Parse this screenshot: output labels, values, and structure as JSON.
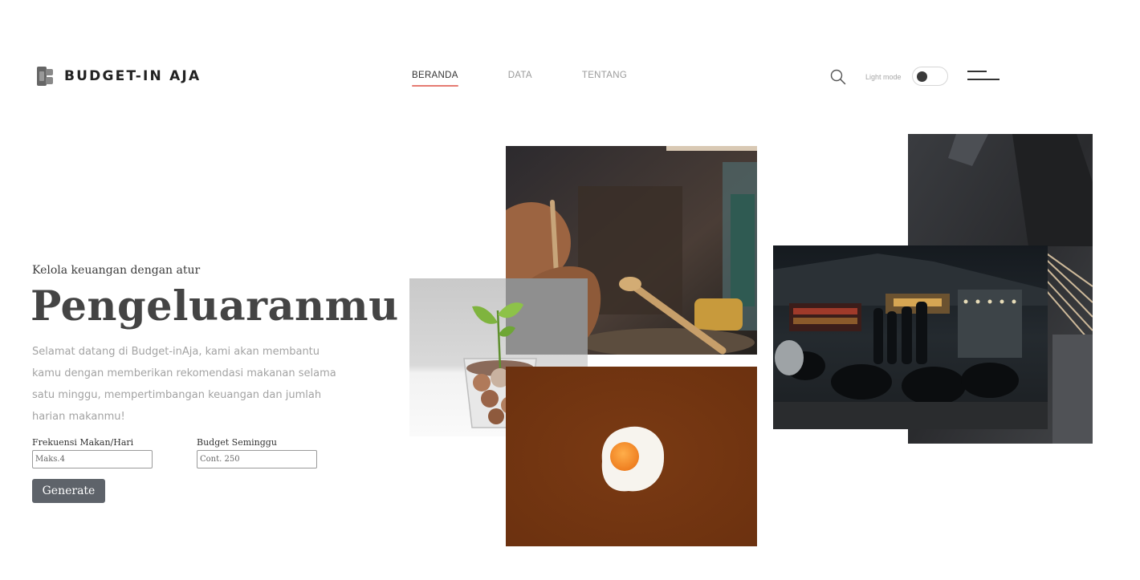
{
  "header": {
    "logo_text": "BUDGET-IN AJA",
    "logo_icon": "budget-logo-icon",
    "nav": [
      {
        "label": "BERANDA",
        "active": true
      },
      {
        "label": "DATA",
        "active": false
      },
      {
        "label": "TENTANG",
        "active": false
      }
    ],
    "search_icon": "search-icon",
    "mode_label": "Light mode",
    "mode_toggle_on": true,
    "menu_icon": "hamburger-menu-icon"
  },
  "hero": {
    "subtitle": "Kelola keuangan dengan atur",
    "title": "Pengeluaranmu",
    "description": "Selamat datang di Budget-inAja, kami akan membantu kamu dengan memberikan rekomendasi makanan selama satu minggu, mempertimbangan keuangan dan jumlah harian makanmu!"
  },
  "form": {
    "frequency_label": "Frekuensi Makan/Hari",
    "frequency_placeholder": "Maks.4",
    "budget_label": "Budget Seminggu",
    "budget_placeholder": "Cont. 250",
    "generate_label": "Generate"
  },
  "colors": {
    "accent": "#e57b72",
    "button": "#5e636a",
    "egg_bg": "#7a3a13"
  }
}
